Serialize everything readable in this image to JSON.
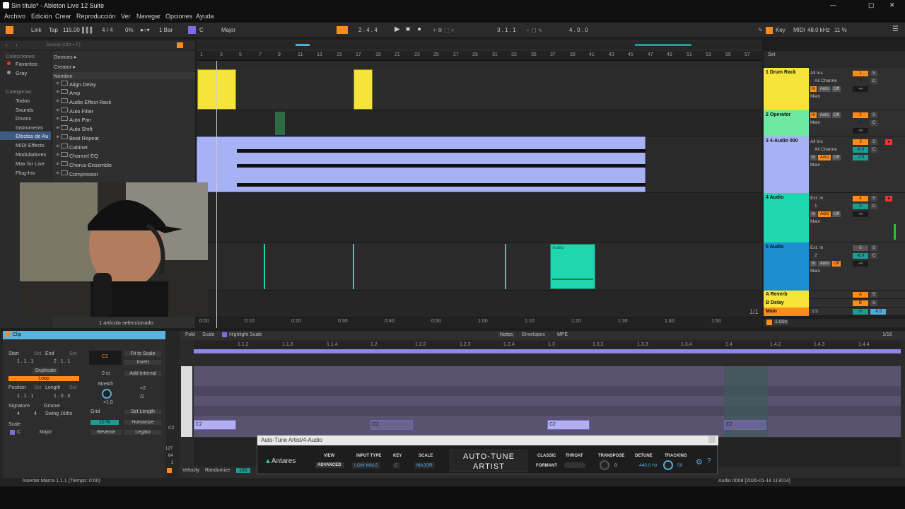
{
  "window": {
    "title": "Sin título* - Ableton Live 12 Suite",
    "minimize": "—",
    "maximize": "▢",
    "close": "✕"
  },
  "menu": [
    "Archivo",
    "Edición",
    "Crear",
    "Reproducción",
    "Ver",
    "Navegar",
    "Opciones",
    "Ayuda"
  ],
  "control_bar": {
    "link": "Link",
    "tap": "Tap",
    "tempo": "115.00",
    "time_sig": "4 / 4",
    "percent": "0%",
    "quantize": "1 Bar",
    "key": "C",
    "scale": "Major",
    "position": "2 . 4 . 4",
    "punch": "3 . 1 . 1",
    "loop_len": "4 . 0 . 0",
    "key_label": "Key",
    "midi_label": "MIDI",
    "sample_rate": "48.0 kHz",
    "cpu": "11 %"
  },
  "browser": {
    "search_placeholder": "Buscar (Ctrl + F)",
    "collections_title": "Colecciones",
    "collections": [
      "Favoritos",
      "Gray"
    ],
    "categories_title": "Categorías",
    "categories": [
      "Todos",
      "Sounds",
      "Drums",
      "Instruments",
      "Efectos de Au",
      "MIDI Effects",
      "Moduladores",
      "Max for Live",
      "Plug-Ins"
    ],
    "breadcrumbs": [
      "Devices ▸",
      "Creator ▸"
    ],
    "column_name": "Nombre",
    "items": [
      "Align Delay",
      "Amp",
      "Audio Effect Rack",
      "Auto Filter",
      "Auto Pan",
      "Auto Shift",
      "Beat Repeat",
      "Cabinet",
      "Channel EQ",
      "Chorus-Ensemble",
      "Compressor"
    ],
    "status": "1 artículo seleccionado"
  },
  "ruler_bars": [
    "1",
    "3",
    "5",
    "7",
    "9",
    "11",
    "13",
    "15",
    "17",
    "19",
    "21",
    "23",
    "25",
    "27",
    "29",
    "31",
    "33",
    "35",
    "37",
    "39",
    "41",
    "43",
    "45",
    "47",
    "49",
    "51",
    "53",
    "55",
    "57"
  ],
  "time_ruler": [
    "0:00",
    "0:10",
    "0:20",
    "0:30",
    "0:40",
    "0:50",
    "1:00",
    "1:10",
    "1:20",
    "1:30",
    "1:40",
    "1:50"
  ],
  "arrangement_info": "1/1",
  "tracks": [
    {
      "name": "1 Drum Rack",
      "color": "#f5e43a",
      "input": "All Ins",
      "channel": "All Channe",
      "output": "Main",
      "number": "1"
    },
    {
      "name": "2 Operator",
      "color": "#6fe8a2",
      "input": "",
      "channel": "",
      "output": "Main",
      "number": "2"
    },
    {
      "name": "3 4-Audio 000",
      "color": "#a7b2f5",
      "input": "All Ins",
      "channel": "All Channe",
      "output": "Main",
      "number": "3"
    },
    {
      "name": "4 Audio",
      "color": "#1fd6b0",
      "input": "Ext. In",
      "channel": "1",
      "output": "Main",
      "number": "4"
    },
    {
      "name": "5 Audio",
      "color": "#1e8ed0",
      "input": "Ext. In",
      "channel": "2",
      "output": "Main",
      "number": "5"
    }
  ],
  "returns": [
    {
      "name": "A Reverb",
      "color": "#f5e43a",
      "letter": "A"
    },
    {
      "name": "B Delay",
      "color": "#f5e43a",
      "letter": "B"
    }
  ],
  "main_track": {
    "name": "Main",
    "color": "#ff8c1a",
    "value": "1/2",
    "gain": "-6.0"
  },
  "set_label": "Set",
  "mixer": {
    "in": "In",
    "auto": "Auto",
    "off": "Off",
    "s": "S",
    "c": "C",
    "inf": "-∞",
    "vol1": "0",
    "vol3": "-6.0",
    "vol3b": "-7.0",
    "vol5": "-6.0"
  },
  "clip_5_label": "Audio",
  "zoom": "1.00x",
  "clip_view": {
    "title": "Clip",
    "start": "Start",
    "end": "End",
    "set": "Set",
    "start_val": "1 . 1 . 1",
    "end_val": "2 . 1 . 1",
    "duplicate": "Duplicate",
    "loop": "Loop",
    "position": "Position",
    "length": "Length",
    "pos_val": "1 . 1 . 1",
    "len_val": "1 . 0 . 0",
    "signature": "Signature",
    "groove": "Groove",
    "sig_num": "4",
    "sig_den": "4",
    "groove_val": "Swing 16ths",
    "scale": "Scale",
    "scale_key": "C",
    "scale_name": "Major",
    "note": "C2",
    "fit": "Fit to Scale",
    "invert": "Invert",
    "semitones": "0 st",
    "add_interval": "Add Interval",
    "stretch": "Stretch",
    "stretch_val": "×1.0",
    "x2": "×2",
    "d2": "/2",
    "grid": "Grid",
    "set_length": "Set Length",
    "humanize_pct": "10 %",
    "humanize": "Humanize",
    "reverse": "Reverse",
    "legato": "Legato",
    "velocity": "Velocity",
    "randomize": "Randomize",
    "vel_val": "100",
    "vel_axis": [
      "127",
      "64",
      "1"
    ]
  },
  "piano_roll": {
    "fold": "Fold",
    "scale": "Scale",
    "highlight": "Highlight Scale",
    "tabs": [
      "Notes",
      "Envelopes",
      "MPE"
    ],
    "page": "1/16",
    "ruler": [
      "1.1.2",
      "1.1.3",
      "1.1.4",
      "1.2",
      "1.2.2",
      "1.2.3",
      "1.2.4",
      "1.3",
      "1.3.2",
      "1.3.3",
      "1.3.4",
      "1.4",
      "1.4.2",
      "1.4.3",
      "1.4.4"
    ],
    "key_label": "C2",
    "notes": [
      "C2",
      "C2",
      "C2",
      "C2"
    ]
  },
  "autotune": {
    "title": "Auto-Tune Artist/4-Audio",
    "brand": "Antares",
    "view": "VIEW",
    "view_val": "ADVANCED",
    "input_type": "INPUT TYPE",
    "input_val": "LOW MALE",
    "key": "KEY",
    "key_val": "C",
    "scale": "SCALE",
    "scale_val": "MAJOR",
    "logo1": "AUTO-TUNE",
    "logo2": "ARTIST",
    "classic": "CLASSIC",
    "formant": "FORMANT",
    "throat": "THROAT",
    "transpose": "TRANSPOSE",
    "transpose_val": "0",
    "detune": "DETUNE",
    "detune_val": "440.0 Hz",
    "tracking": "TRACKING",
    "tracking_val": "50"
  },
  "status_bar": {
    "left": "Insertar Marca 1.1.1 (Tiempo: 0:00)",
    "right": "Audio 0008 [2026-01-14 113014]"
  }
}
